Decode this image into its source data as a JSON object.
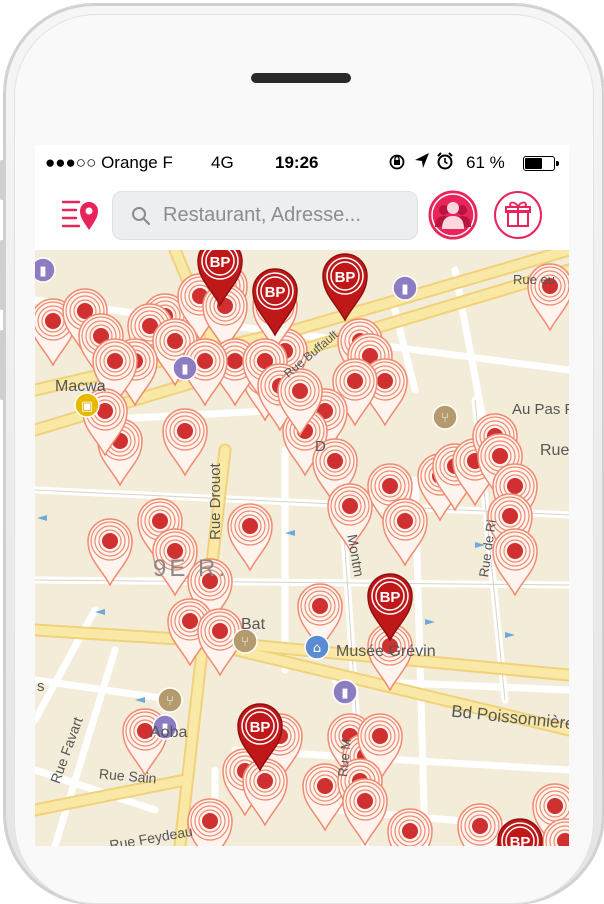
{
  "status_bar": {
    "carrier": "●●●○○ Orange F",
    "network": "4G",
    "time": "19:26",
    "battery": "61 %",
    "battery_level": 0.61
  },
  "nav": {
    "search_placeholder": "Restaurant, Adresse..."
  },
  "map": {
    "labels": {
      "macway": "Macwa",
      "rue_drouot": "Rue Drouot",
      "arr": "9E  R.",
      "bat": "Bat",
      "musee": "Musée Grévin",
      "aoba": "Aoba",
      "bd_poissonniere": "Bd Poissonnière",
      "rue_favart": "Rue Favart",
      "rue_sain": "Rue Sain",
      "rue_feydeau": "Rue Feydeau",
      "au_pas": "Au Pas Pr",
      "rue_right": "Rue",
      "rue_top": "Rue   eu",
      "rue_buffault": "Rue Buffault",
      "rue_rich": "Rue de Ri",
      "montmartre": "Montm",
      "rue_ms": "Rue M",
      "d_label": "D",
      "left_s": "s"
    },
    "bp_label": "BP",
    "colors": {
      "pin_red": "#d03030",
      "pin_ring": "#f08a70",
      "brand_pink": "#e8245a",
      "road_yellow": "#f8df8a",
      "map_bg": "#f3ecd9"
    }
  }
}
